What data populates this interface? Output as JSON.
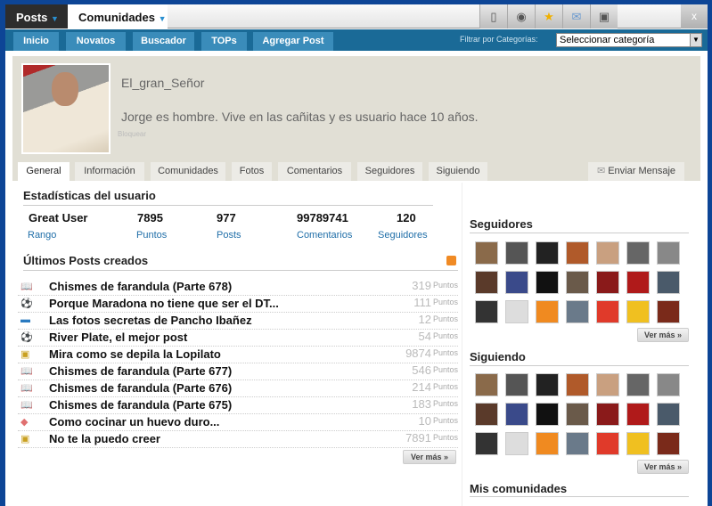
{
  "topbar": {
    "posts": "Posts",
    "comunidades": "Comunidades",
    "icons": [
      "clipboard-icon",
      "eye-icon",
      "star-icon",
      "mail-icon",
      "monitor-icon"
    ],
    "close": "x"
  },
  "nav": {
    "items": [
      "Inicio",
      "Novatos",
      "Buscador",
      "TOPs",
      "Agregar Post"
    ],
    "filter_label": "Filtrar por Categorías:",
    "select_value": "Seleccionar categoría"
  },
  "profile": {
    "username": "El_gran_Señor",
    "bio": "Jorge es hombre. Vive en las cañitas y es usuario hace 10 años.",
    "block": "Bloquear",
    "tabs": [
      "General",
      "Información",
      "Comunidades",
      "Fotos",
      "Comentarios",
      "Seguidores",
      "Siguiendo"
    ],
    "send_message": "Enviar Mensaje"
  },
  "stats": {
    "title": "Estadísticas del usuario",
    "items": [
      {
        "value": "Great User",
        "label": "Rango"
      },
      {
        "value": "7895",
        "label": "Puntos"
      },
      {
        "value": "977",
        "label": "Posts"
      },
      {
        "value": "99789741",
        "label": "Comentarios"
      },
      {
        "value": "120",
        "label": "Seguidores"
      }
    ]
  },
  "posts": {
    "title": "Últimos Posts creados",
    "unit": "Puntos",
    "more": "Ver más »",
    "items": [
      {
        "icon": "book-icon",
        "title": "Chismes de farandula (Parte 678)",
        "points": "319"
      },
      {
        "icon": "soccer-ball-icon",
        "title": "Porque Maradona no tiene que ser el DT...",
        "points": "111"
      },
      {
        "icon": "tv-icon",
        "title": "Las fotos secretas de Pancho Ibañez",
        "points": "12"
      },
      {
        "icon": "soccer-ball-icon",
        "title": "River Plate, el mejor post",
        "points": "54"
      },
      {
        "icon": "photos-icon",
        "title": "Mira como se depila la Lopilato",
        "points": "9874"
      },
      {
        "icon": "book-icon",
        "title": "Chismes de farandula (Parte 677)",
        "points": "546"
      },
      {
        "icon": "book-icon",
        "title": "Chismes de farandula (Parte 676)",
        "points": "214"
      },
      {
        "icon": "book-icon",
        "title": "Chismes de farandula (Parte 675)",
        "points": "183"
      },
      {
        "icon": "cake-icon",
        "title": "Como cocinar un huevo duro...",
        "points": "10"
      },
      {
        "icon": "photos-icon",
        "title": "No te la puedo creer",
        "points": "7891"
      }
    ]
  },
  "sidebar": {
    "seguidores": "Seguidores",
    "siguiendo": "Siguiendo",
    "mis_comunidades": "Mis comunidades",
    "more": "Ver más »",
    "avatar_colors": [
      "#8a6a4a",
      "#555",
      "#222",
      "#b05a2a",
      "#c9a080",
      "#666",
      "#888",
      "#5a3a2a",
      "#3a4a8a",
      "#111",
      "#6a5a4a",
      "#8a1a1a",
      "#b01a1a",
      "#4a5a6a",
      "#333",
      "#ddd",
      "#f08a20",
      "#6a7a8a",
      "#e03a2a",
      "#f0c020",
      "#7a2a1a"
    ]
  }
}
